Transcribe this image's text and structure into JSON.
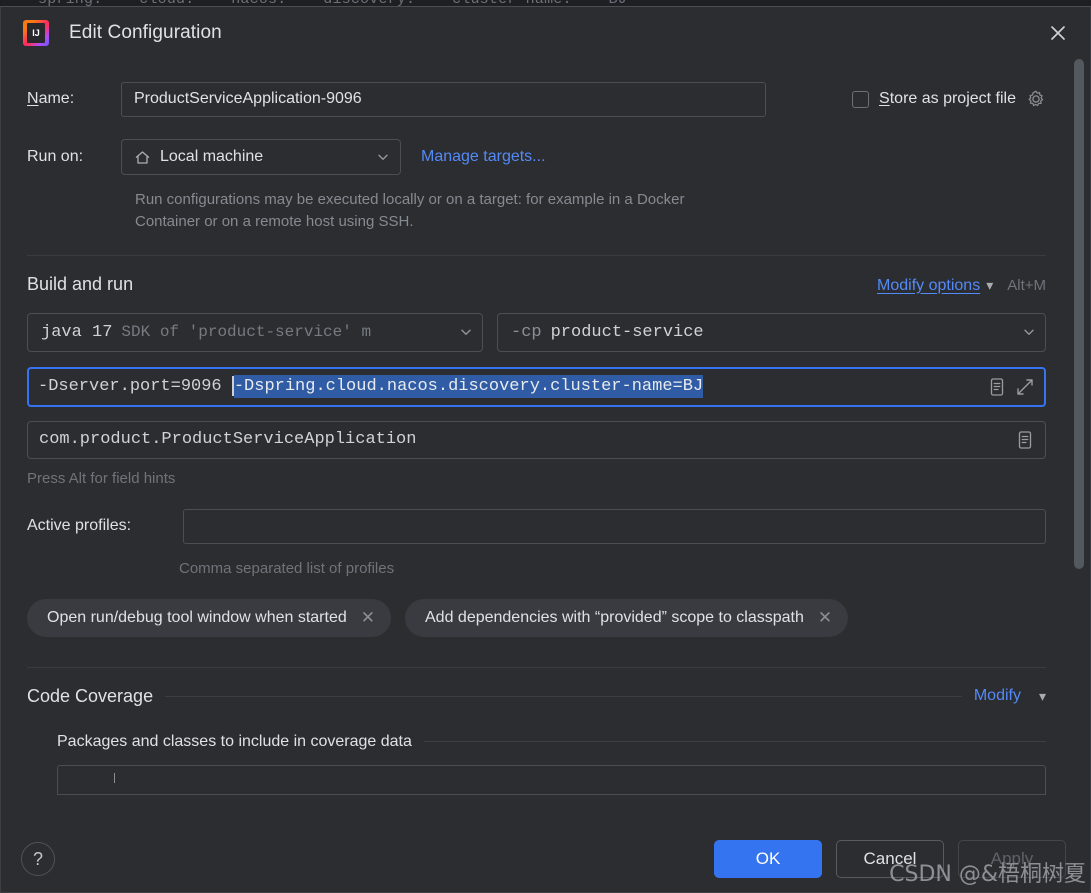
{
  "background_editor": {
    "code_line": "spring:    cloud:    nacos:    discovery:    cluster-name:    BJ"
  },
  "titlebar": {
    "app_icon": "intellij-idea-logo",
    "title": "Edit Configuration",
    "close_icon": "close-icon"
  },
  "form": {
    "name": {
      "label_prefix": "N",
      "label_rest": "ame:",
      "value": "ProductServiceApplication-9096",
      "placeholder": ""
    },
    "store_as_project_file": {
      "checked": false,
      "label_prefix": "S",
      "label_rest": "tore as project file",
      "gear_icon": "gear-icon"
    },
    "run_on": {
      "label": "Run on:",
      "value": "Local machine",
      "icon": "home-icon",
      "chevron": "chevron-down-icon",
      "manage_targets_link": "Manage targets...",
      "description": "Run configurations may be executed locally or on a target: for example in a Docker Container or on a remote host using SSH."
    }
  },
  "build_and_run": {
    "title": "Build and run",
    "modify_options_link": "Modify options",
    "modify_options_chevron": "chevron-down-icon",
    "shortcut": "Alt+M",
    "sdk_combo": {
      "value": "java 17",
      "secondary": "SDK of 'product-service' m",
      "chevron": "chevron-down-icon"
    },
    "classpath_combo": {
      "flag": "-cp",
      "value": "product-service",
      "chevron": "chevron-down-icon"
    },
    "vm_options": {
      "text_before_caret": "-Dserver.port=9096 ",
      "selected_text": "-Dspring.cloud.nacos.discovery.cluster-name=BJ",
      "expand_editor_icon": "document-editor-icon",
      "fullscreen_icon": "expand-diagonal-icon",
      "focused": true
    },
    "main_class": {
      "value": "com.product.ProductServiceApplication",
      "expand_editor_icon": "document-editor-icon"
    },
    "field_hint": "Press Alt for field hints",
    "active_profiles": {
      "label": "Active profiles:",
      "value": "",
      "hint": "Comma separated list of profiles"
    },
    "option_chips": [
      {
        "label": "Open run/debug tool window when started",
        "remove_icon": "close-small-icon"
      },
      {
        "label": "Add dependencies with “provided” scope to classpath",
        "remove_icon": "close-small-icon"
      }
    ]
  },
  "code_coverage": {
    "title": "Code Coverage",
    "modify_link": "Modify",
    "modify_chevron": "chevron-down-icon",
    "packages_title": "Packages and classes to include in coverage data"
  },
  "footer": {
    "help_icon": "question-mark-icon",
    "ok_label": "OK",
    "cancel_label": "Cancel",
    "apply_label": "Apply",
    "apply_enabled": false
  },
  "watermark": "CSDN @&梧桐树夏",
  "colors": {
    "dialog_background": "#2b2d30",
    "editor_background": "#1e1f22",
    "text_primary": "#dfe1e5",
    "text_secondary": "#868a91",
    "accent_blue": "#3574f0",
    "link_blue": "#548af7",
    "selection_blue": "#2f5ca5",
    "border": "#4b4e54",
    "chip_background": "#393b40"
  }
}
